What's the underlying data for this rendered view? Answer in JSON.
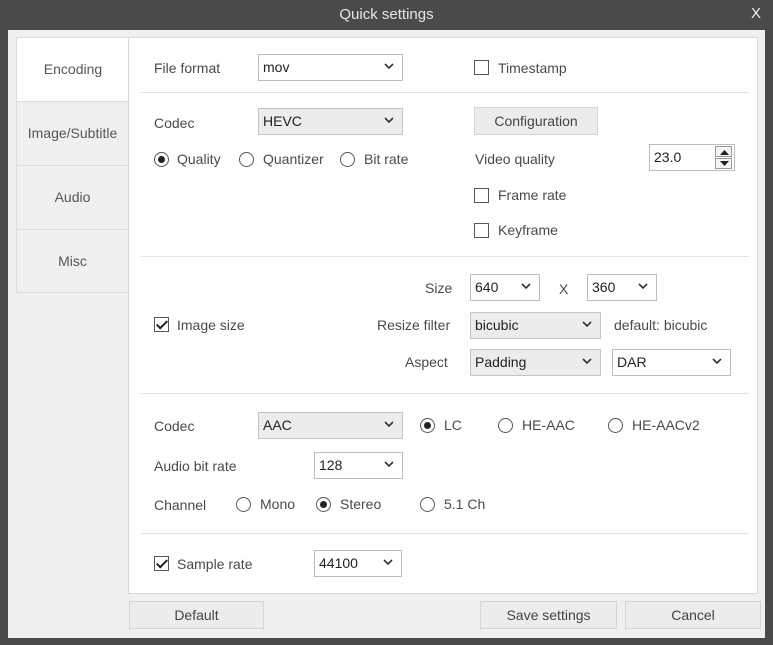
{
  "window": {
    "title": "Quick settings",
    "close_glyph": "X"
  },
  "tabs": [
    {
      "label": "Encoding",
      "active": true
    },
    {
      "label": "Image/Subtitle",
      "active": false
    },
    {
      "label": "Audio",
      "active": false
    },
    {
      "label": "Misc",
      "active": false
    }
  ],
  "format": {
    "label": "File format",
    "value": "mov",
    "timestamp_label": "Timestamp",
    "timestamp_checked": false
  },
  "video": {
    "codec_label": "Codec",
    "codec_value": "HEVC",
    "config_button": "Configuration",
    "rate_modes": [
      "Quality",
      "Quantizer",
      "Bit rate"
    ],
    "rate_selected": "Quality",
    "quality_label": "Video quality",
    "quality_value": "23.0",
    "frame_rate_label": "Frame rate",
    "keyframe_label": "Keyframe"
  },
  "image": {
    "size_label": "Size",
    "width": "640",
    "x_glyph": "X",
    "height": "360",
    "image_size_label": "Image size",
    "image_size_checked": true,
    "resize_label": "Resize filter",
    "resize_value": "bicubic",
    "resize_hint": "default: bicubic",
    "aspect_label": "Aspect",
    "aspect_value": "Padding",
    "aspect_mode": "DAR"
  },
  "audio": {
    "codec_label": "Codec",
    "codec_value": "AAC",
    "profiles": [
      "LC",
      "HE-AAC",
      "HE-AACv2"
    ],
    "profile_selected": "LC",
    "bitrate_label": "Audio bit rate",
    "bitrate_value": "128",
    "channel_label": "Channel",
    "channels": [
      "Mono",
      "Stereo",
      "5.1 Ch"
    ],
    "channel_selected": "Stereo"
  },
  "misc": {
    "sample_rate_label": "Sample rate",
    "sample_rate_checked": true,
    "sample_rate_value": "44100"
  },
  "footer": {
    "default": "Default",
    "save": "Save settings",
    "cancel": "Cancel"
  }
}
